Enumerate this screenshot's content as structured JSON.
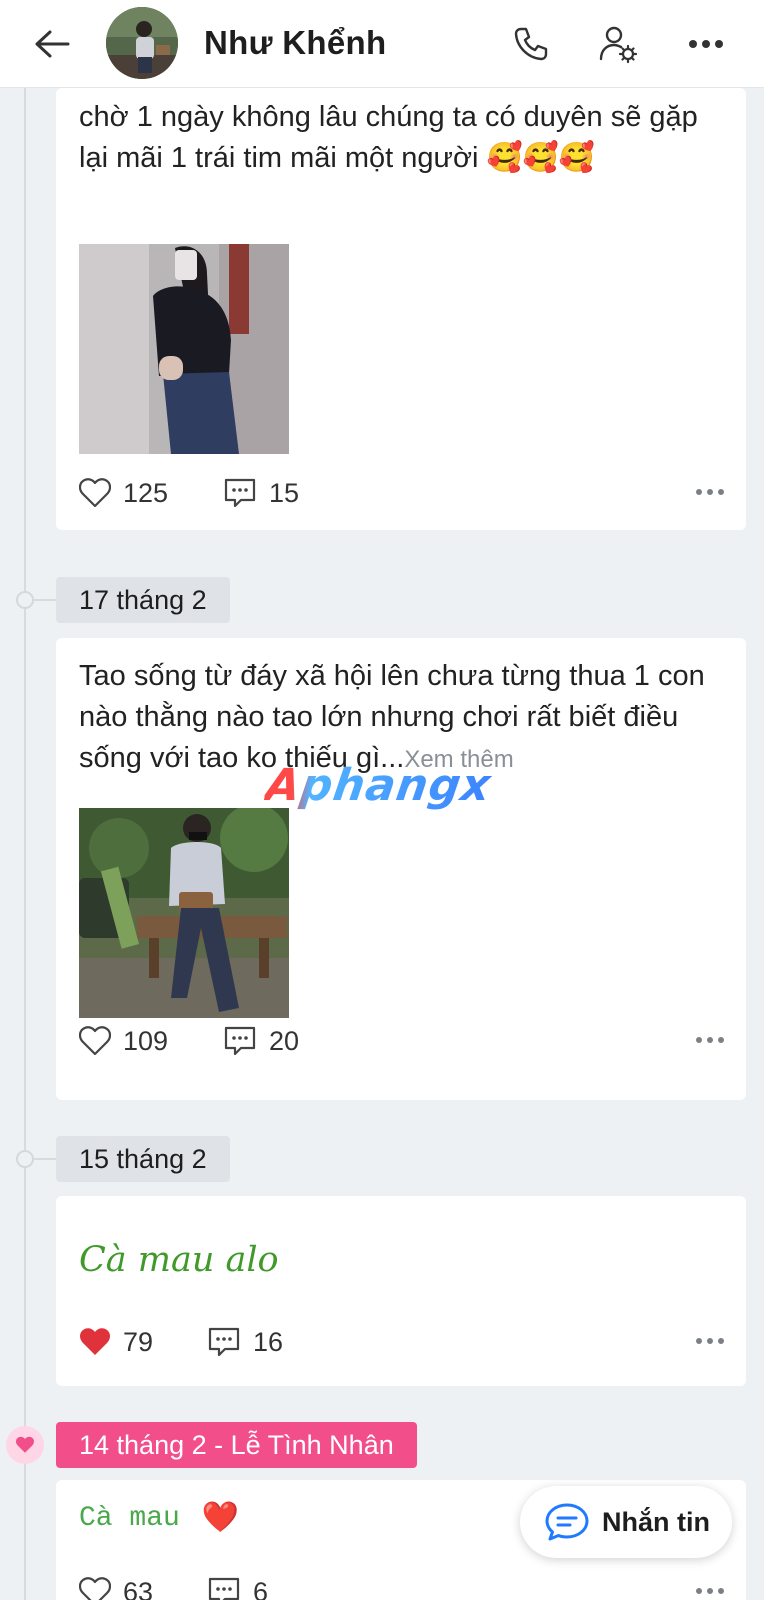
{
  "header": {
    "title": "Như Khểnh",
    "icons": [
      "back-arrow-icon",
      "phone-icon",
      "profile-settings-icon",
      "more-icon"
    ]
  },
  "posts": [
    {
      "text": "chờ 1 ngày không lâu chúng ta có duyên sẽ gặp lại mãi 1 trái tim mãi một người 🥰🥰🥰",
      "likes": "125",
      "comments": "15",
      "liked": false
    },
    {
      "date": "17 tháng 2",
      "text": "Tao sống từ đáy xã hội lên chưa từng thua 1 con nào thằng nào tao lớn nhưng chơi rất biết điều sống với tao ko thiếu gì...",
      "see_more": "Xem thêm",
      "likes": "109",
      "comments": "20",
      "liked": false
    },
    {
      "date": "15 tháng 2",
      "text": "Cà mau alo",
      "likes": "79",
      "comments": "16",
      "liked": true,
      "text_color": "#3f9a2a"
    },
    {
      "date": "14 tháng 2 - Lễ Tình Nhân",
      "text": "Cà mau",
      "emoji": "❤️",
      "likes": "63",
      "comments": "6",
      "liked": false,
      "date_color": "#f24f8a"
    }
  ],
  "watermark": "Aphangx",
  "message_button": {
    "label": "Nhắn tin"
  },
  "colors": {
    "accent_pink": "#f24f8a",
    "like_red": "#e0323a",
    "background": "#eef1f4"
  }
}
